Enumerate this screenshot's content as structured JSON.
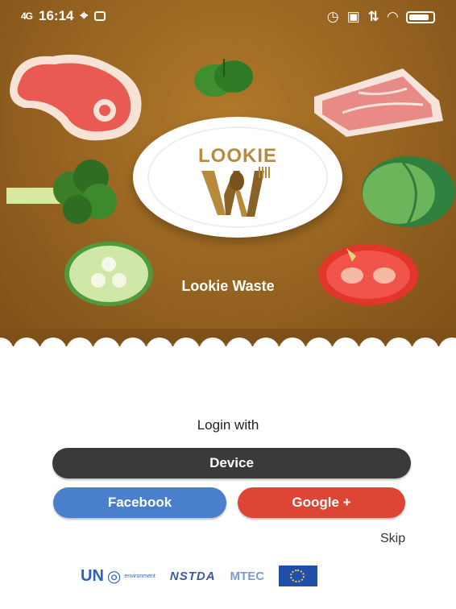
{
  "status_bar": {
    "signal": "4G",
    "time": "16:14",
    "icons": [
      "signal-icon",
      "location-icon",
      "notification-icon",
      "alarm-icon",
      "sim-icon",
      "data-icon",
      "wifi-icon",
      "battery-icon"
    ]
  },
  "app": {
    "logo_text": "LOOKIE",
    "name": "Lookie Waste"
  },
  "login": {
    "title": "Login with",
    "device_label": "Device",
    "facebook_label": "Facebook",
    "google_label": "Google +",
    "skip_label": "Skip"
  },
  "partners": {
    "un": "UN",
    "un_sub": "environment",
    "nstda": "NSTDA",
    "mtec": "MTEC",
    "eu": "EU flag"
  },
  "colors": {
    "hero_brown": "#9a6622",
    "device_button": "#3a3a3a",
    "facebook_button": "#4a7fcb",
    "google_button": "#dd4535",
    "logo_gold": "#b88a3c"
  }
}
